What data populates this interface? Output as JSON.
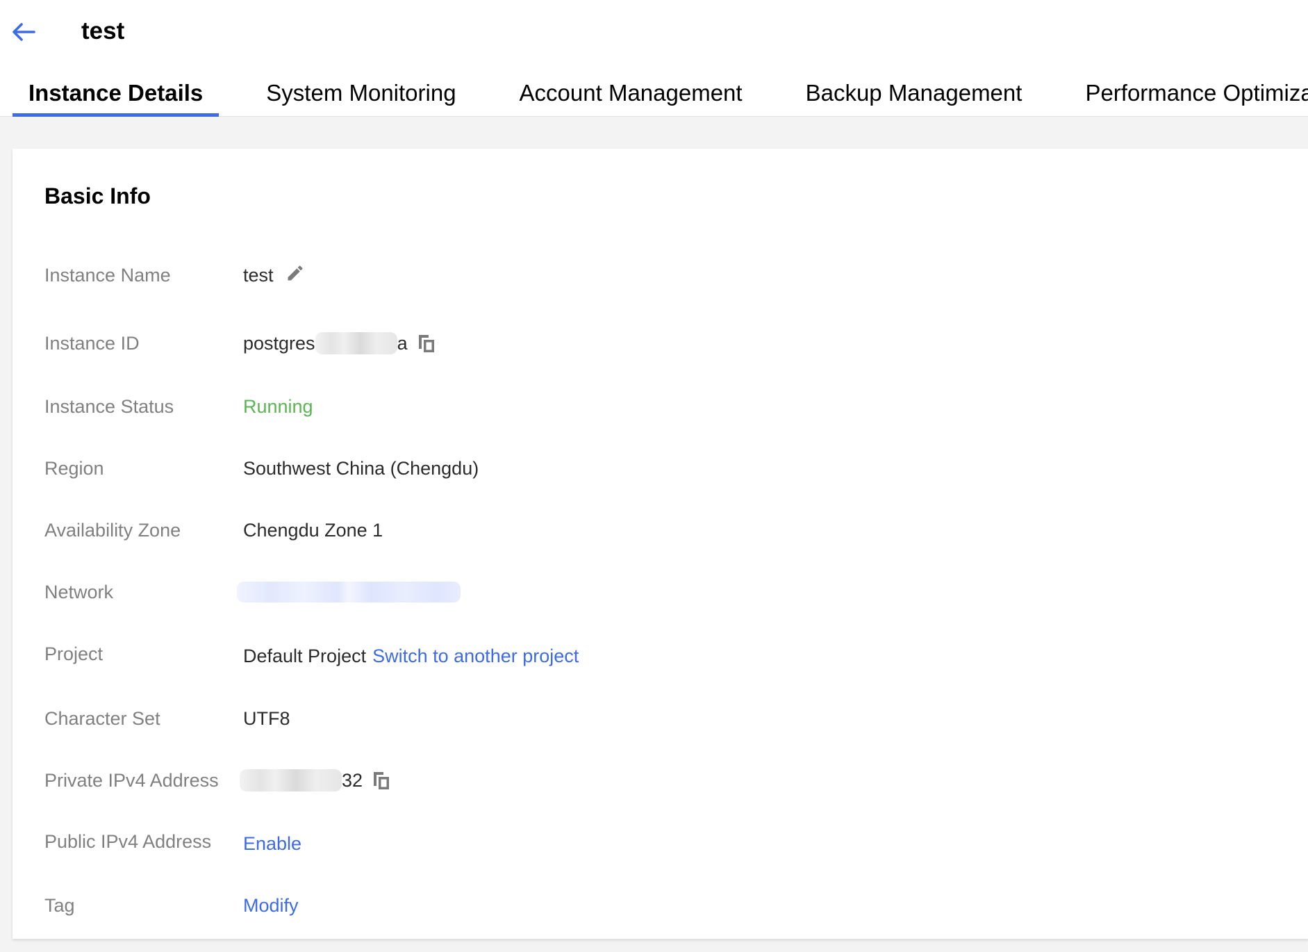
{
  "header": {
    "title": "test",
    "back_icon": "arrow-left-icon",
    "accent_color": "#3d6be6"
  },
  "tabs": [
    {
      "label": "Instance Details",
      "active": true
    },
    {
      "label": "System Monitoring",
      "active": false
    },
    {
      "label": "Account Management",
      "active": false
    },
    {
      "label": "Backup Management",
      "active": false
    },
    {
      "label": "Performance Optimization",
      "active": false
    }
  ],
  "basic_info": {
    "title": "Basic Info",
    "instance_name": {
      "label": "Instance Name",
      "value": "test",
      "edit_icon": "pencil-icon"
    },
    "instance_id": {
      "label": "Instance ID",
      "value_prefix": "postgres",
      "value_suffix": "a",
      "copy_icon": "copy-icon"
    },
    "instance_status": {
      "label": "Instance Status",
      "value": "Running",
      "color": "#5ab552"
    },
    "region": {
      "label": "Region",
      "value": "Southwest China (Chengdu)"
    },
    "availability_zone": {
      "label": "Availability Zone",
      "value": "Chengdu Zone 1"
    },
    "network": {
      "label": "Network"
    },
    "project": {
      "label": "Project",
      "value": "Default Project",
      "link": "Switch to another project"
    },
    "character_set": {
      "label": "Character Set",
      "value": "UTF8"
    },
    "private_ipv4": {
      "label": "Private IPv4 Address",
      "value_suffix": "32",
      "copy_icon": "copy-icon"
    },
    "public_ipv4": {
      "label": "Public IPv4 Address",
      "link": "Enable"
    },
    "tag": {
      "label": "Tag",
      "link": "Modify"
    }
  }
}
